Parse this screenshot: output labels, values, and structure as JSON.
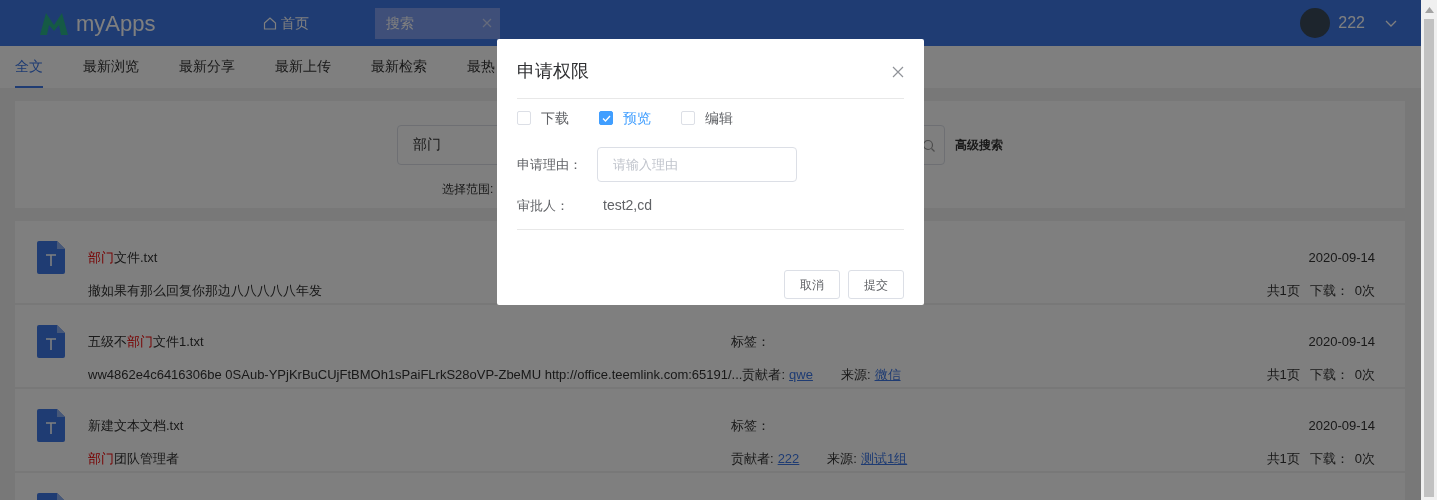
{
  "header": {
    "logo_text": "myApps",
    "home_link": "首页",
    "open_tab": {
      "label": "搜索"
    },
    "user": {
      "name": "222"
    }
  },
  "nav_tabs": [
    {
      "label": "全文",
      "selected": true
    },
    {
      "label": "最新浏览",
      "selected": false
    },
    {
      "label": "最新分享",
      "selected": false
    },
    {
      "label": "最新上传",
      "selected": false
    },
    {
      "label": "最新检索",
      "selected": false
    },
    {
      "label": "最热",
      "selected": false
    }
  ],
  "search": {
    "value": "部门",
    "advanced_link": "高级搜索",
    "scope_label": "选择范围:"
  },
  "results": [
    {
      "title": [
        {
          "text": "部门",
          "highlight": true
        },
        {
          "text": "文件.txt",
          "highlight": false
        }
      ],
      "description": [
        {
          "text": "撤如果有那么回复你那边八八八八八年发",
          "highlight": false
        }
      ],
      "date": "2020-09-14",
      "pages": "共1页",
      "downloads_label": "下载：",
      "downloads": "0次"
    },
    {
      "title": [
        {
          "text": "五级不",
          "highlight": false
        },
        {
          "text": "部门",
          "highlight": true
        },
        {
          "text": "文件1.txt",
          "highlight": false
        }
      ],
      "description": [
        {
          "text": "ww4862e4c6416306be 0SAub-YPjKrBuCUjFtBMOh1sPaiFLrkS28oVP-ZbeMU http://office.teemlink.com:65191/...",
          "highlight": false
        }
      ],
      "tag_label": "标签：",
      "contributor": {
        "label": "贡献者:",
        "name": "qwe"
      },
      "source": {
        "label": "来源:",
        "name": "微信"
      },
      "date": "2020-09-14",
      "pages": "共1页",
      "downloads_label": "下载：",
      "downloads": "0次"
    },
    {
      "title": [
        {
          "text": "新建文本文档.txt",
          "highlight": false
        }
      ],
      "description": [
        {
          "text": "部门",
          "highlight": true
        },
        {
          "text": "团队管理者",
          "highlight": false
        }
      ],
      "tag_label": "标签：",
      "contributor": {
        "label": "贡献者:",
        "name": "222"
      },
      "source": {
        "label": "来源:",
        "name": "测试1组"
      },
      "date": "2020-09-14",
      "pages": "共1页",
      "downloads_label": "下载：",
      "downloads": "0次"
    }
  ],
  "dialog": {
    "title": "申请权限",
    "permissions": [
      {
        "label": "下载",
        "checked": false
      },
      {
        "label": "预览",
        "checked": true
      },
      {
        "label": "编辑",
        "checked": false
      }
    ],
    "reason": {
      "label": "申请理由：",
      "placeholder": "请输入理由"
    },
    "approver": {
      "label": "审批人：",
      "value": "test2,cd"
    },
    "buttons": [
      {
        "label": "取消"
      },
      {
        "label": "提交"
      }
    ]
  }
}
